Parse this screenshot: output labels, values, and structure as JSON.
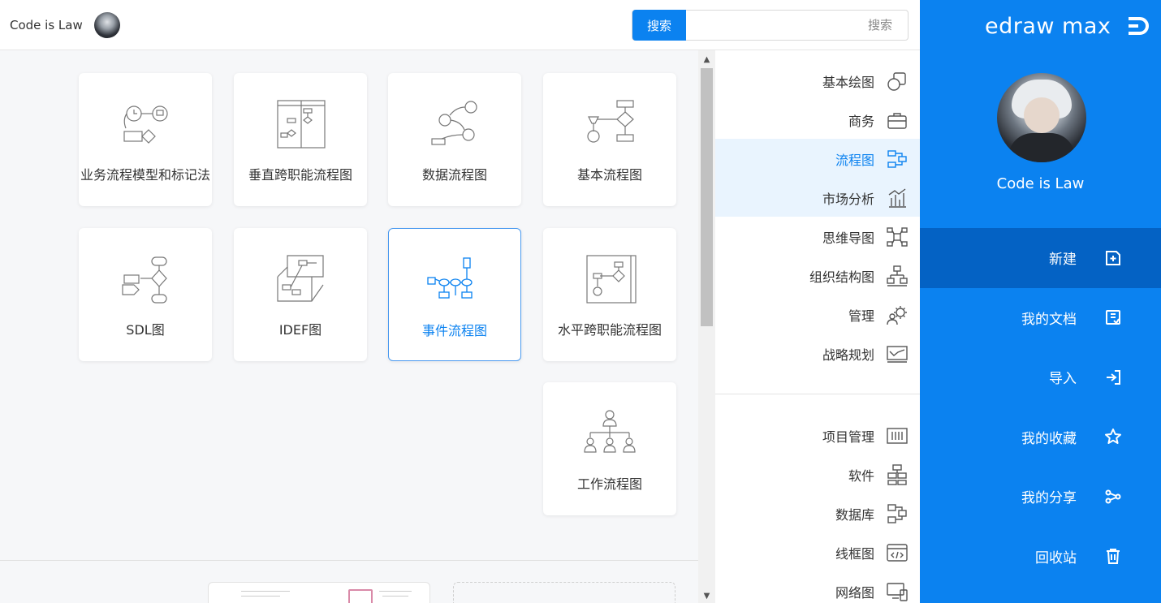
{
  "brand": {
    "name": "edraw max"
  },
  "user": {
    "name": "Code is Law"
  },
  "search": {
    "button_label": "搜索",
    "placeholder": "搜索"
  },
  "sidebar": {
    "items": [
      {
        "label": "新建",
        "icon": "new-doc-icon",
        "active": true
      },
      {
        "label": "我的文档",
        "icon": "my-docs-icon",
        "active": false
      },
      {
        "label": "导入",
        "icon": "import-icon",
        "active": false
      },
      {
        "label": "我的收藏",
        "icon": "star-icon",
        "active": false
      },
      {
        "label": "我的分享",
        "icon": "share-icon",
        "active": false
      },
      {
        "label": "回收站",
        "icon": "trash-icon",
        "active": false
      }
    ]
  },
  "categories": {
    "top": [
      {
        "label": "基本绘图",
        "icon": "basic-shapes-icon"
      },
      {
        "label": "商务",
        "icon": "briefcase-icon"
      },
      {
        "label": "流程图",
        "icon": "flowchart-icon",
        "active": true
      },
      {
        "label": "市场分析",
        "icon": "market-chart-icon"
      },
      {
        "label": "思维导图",
        "icon": "mindmap-icon"
      },
      {
        "label": "组织结构图",
        "icon": "org-chart-icon"
      },
      {
        "label": "管理",
        "icon": "gear-people-icon"
      },
      {
        "label": "战略规划",
        "icon": "strategy-icon"
      }
    ],
    "bottom": [
      {
        "label": "项目管理",
        "icon": "project-icon"
      },
      {
        "label": "软件",
        "icon": "software-icon"
      },
      {
        "label": "数据库",
        "icon": "database-icon"
      },
      {
        "label": "线框图",
        "icon": "wireframe-icon"
      },
      {
        "label": "网络图",
        "icon": "network-icon"
      }
    ]
  },
  "templates": [
    {
      "label": "基本流程图"
    },
    {
      "label": "数据流程图"
    },
    {
      "label": "垂直跨职能流程图"
    },
    {
      "label": "业务流程模型和标记法"
    },
    {
      "label": "水平跨职能流程图"
    },
    {
      "label": "事件流程图",
      "selected": true
    },
    {
      "label": "IDEF图"
    },
    {
      "label": "SDL图"
    },
    {
      "label": "工作流程图"
    }
  ],
  "colors": {
    "primary": "#0b82f0",
    "active_nav": "#0462c4",
    "highlight": "#e9f4fe"
  }
}
